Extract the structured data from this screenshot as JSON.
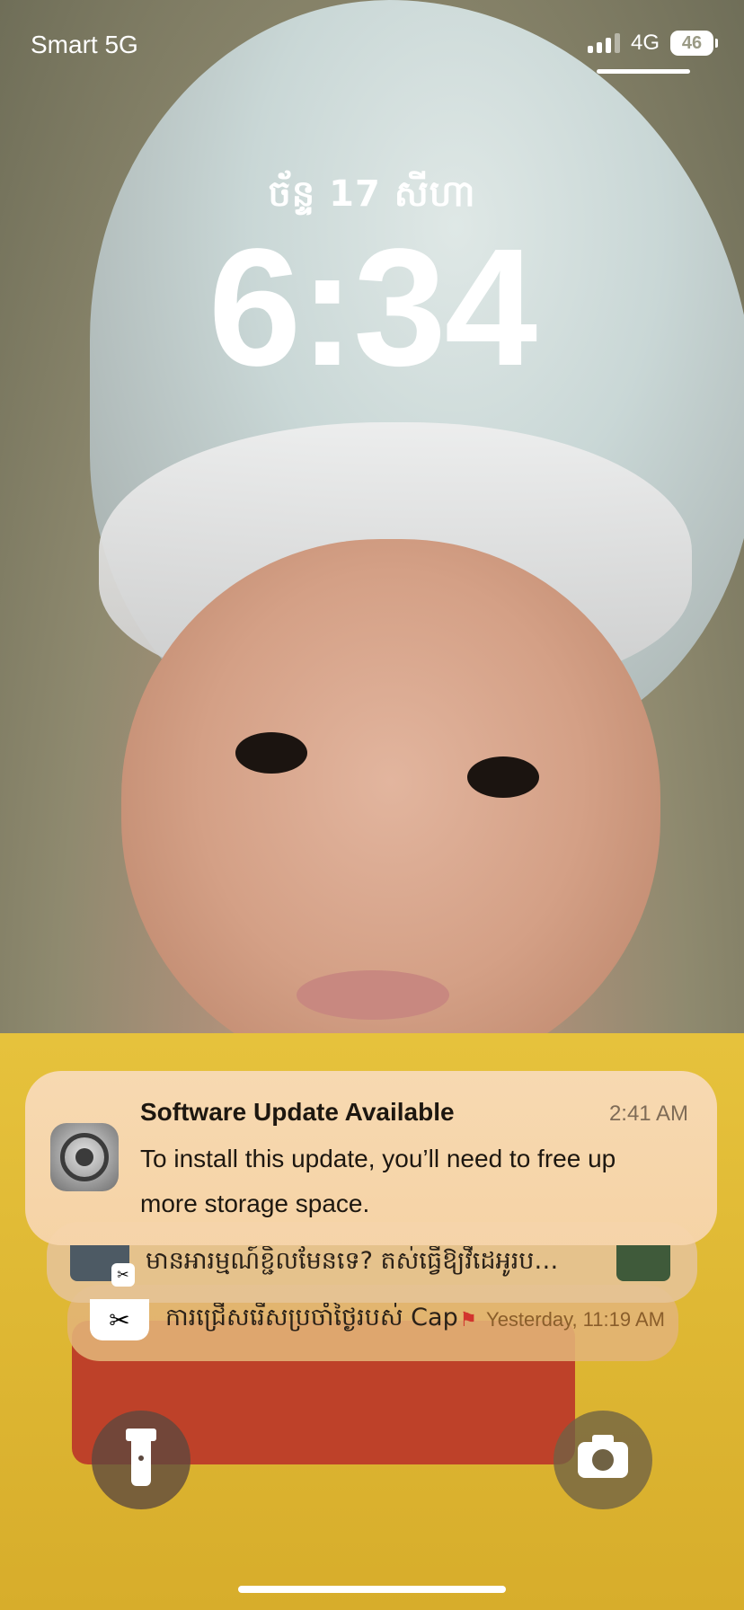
{
  "status_bar": {
    "carrier": "Smart 5G",
    "network": "4G",
    "battery": "46"
  },
  "lockscreen": {
    "date": "ច័ន្ទ 17 សីហា",
    "time": "6:34"
  },
  "notifications": {
    "main": {
      "app_icon": "settings-gear-icon",
      "title": "Software Update Available",
      "time": "2:41 AM",
      "body": "To install this update, you’ll need to free up more storage space."
    },
    "stack": [
      {
        "text": "មានអារម្មណ៍ខ្ជិលមែនទេ? តស់ធ្វើឱ្យវីដេអូរប…"
      },
      {
        "app": "CapCut",
        "text": "ការជ្រើសរើសប្រចាំថ្ងៃរបស់ CapCut",
        "time": "Yesterday, 11:19 AM"
      }
    ]
  },
  "quick_actions": {
    "left": "flashlight-icon",
    "right": "camera-icon"
  }
}
